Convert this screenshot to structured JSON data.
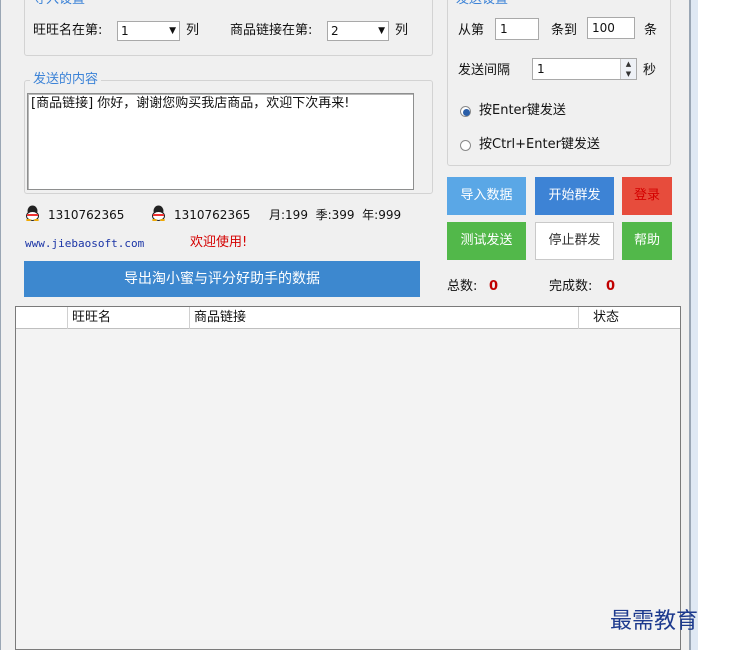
{
  "import_settings": {
    "legend": "导入设置",
    "wangwang_col_label": "旺旺名在第:",
    "wangwang_col_value": "1",
    "col_suffix": "列",
    "link_col_label": "商品链接在第:",
    "link_col_value": "2"
  },
  "content": {
    "legend": "发送的内容",
    "message": "[商品链接] 你好，谢谢您购买我店商品，欢迎下次再来!"
  },
  "info": {
    "qq1": "1310762365",
    "qq2": "1310762365",
    "price_text": "月:199  季:399  年:999",
    "website": "www.jiebaosoft.com",
    "welcome": "欢迎使用!"
  },
  "export_button": "导出淘小蜜与评分好助手的数据",
  "send_settings": {
    "legend": "发送设置",
    "from_label": "从第",
    "from_value": "1",
    "to_label": "条到",
    "to_value": "100",
    "unit_label": "条",
    "interval_label": "发送间隔",
    "interval_value": "1",
    "interval_unit": "秒",
    "radio_enter": "按Enter键发送",
    "radio_ctrl_enter": "按Ctrl+Enter键发送",
    "selected": "radio_enter"
  },
  "buttons": {
    "import_data": "导入数据",
    "start_send": "开始群发",
    "login": "登录",
    "test_send": "测试发送",
    "stop_send": "停止群发",
    "help": "帮助"
  },
  "stats": {
    "total_label": "总数:",
    "total_value": "0",
    "done_label": "完成数:",
    "done_value": "0"
  },
  "table": {
    "columns": [
      "",
      "旺旺名",
      "商品链接",
      "状态"
    ],
    "rows": []
  },
  "watermark": "最需教育",
  "colors": {
    "legend": "#3c83d7",
    "btn_blue": "#5aa7e6",
    "btn_blue_dark": "#3d83d5",
    "btn_red": "#e74c3c",
    "btn_green": "#52b84a"
  }
}
